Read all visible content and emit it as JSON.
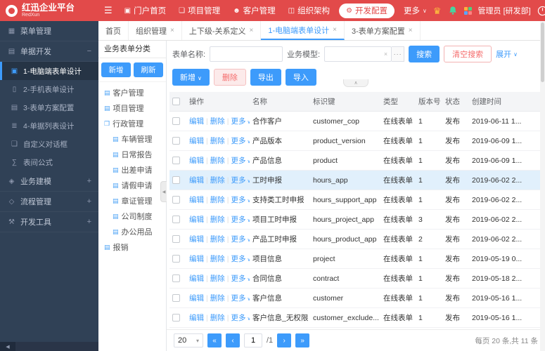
{
  "colors": {
    "brand_red": "#e24a4a",
    "accent_blue": "#3d9bfb",
    "success_green": "#45b34a",
    "danger_red": "#f56c6c",
    "sidebar_bg": "#304156",
    "row_highlight": "#e1f0fc"
  },
  "icons": {
    "hamburger": "☰",
    "caret_down": "∨",
    "select_caret": "▾",
    "close": "×",
    "minus": "−",
    "plus": "+",
    "separator": "|",
    "collapse_up": "∧",
    "collapse_left": "◀",
    "trophy": "♛",
    "page_first": "«",
    "page_prev": "‹",
    "page_next": "›",
    "page_last": "»",
    "model_clear": "×",
    "model_picker": "···"
  },
  "header": {
    "logo_title": "红迅企业平台",
    "logo_subtitle": "RedXun",
    "nav": [
      {
        "id": "portal-home",
        "label": "门户首页",
        "glyph": "▣"
      },
      {
        "id": "project-mgmt",
        "label": "项目管理",
        "glyph": "❏"
      },
      {
        "id": "customer-mgmt",
        "label": "客户管理",
        "glyph": "☻"
      },
      {
        "id": "org-structure",
        "label": "组织架构",
        "glyph": "◫"
      },
      {
        "id": "dev-config",
        "label": "开发配置",
        "glyph": "⚙",
        "active": true
      },
      {
        "id": "more",
        "label": "更多",
        "caret": true
      }
    ],
    "user": "管理员 [研发部]"
  },
  "tabbar": [
    {
      "id": "home",
      "label": "首页",
      "closable": false
    },
    {
      "id": "org-mgmt",
      "label": "组织管理",
      "closable": true
    },
    {
      "id": "relation-def",
      "label": "上下级-关系定义",
      "closable": true
    },
    {
      "id": "pc-form-design",
      "label": "1-电脑端表单设计",
      "closable": true,
      "active": true
    },
    {
      "id": "form-scheme-config",
      "label": "3-表单方案配置",
      "closable": true
    }
  ],
  "sidebar": {
    "items": [
      {
        "id": "menu-mgmt",
        "label": "菜单管理",
        "glyph": "▦",
        "type": "item"
      },
      {
        "id": "doc-dev",
        "label": "单据开发",
        "glyph": "▤",
        "type": "group",
        "expanded": true,
        "children": [
          {
            "id": "pc-form-design",
            "label": "1-电脑端表单设计",
            "glyph": "▣",
            "active": true
          },
          {
            "id": "mobile-form-design",
            "label": "2-手机表单设计",
            "glyph": "▯"
          },
          {
            "id": "form-scheme-config",
            "label": "3-表单方案配置",
            "glyph": "▤"
          },
          {
            "id": "doc-list-design",
            "label": "4-单据列表设计",
            "glyph": "≣"
          },
          {
            "id": "custom-dialog",
            "label": "自定义对话框",
            "glyph": "❑"
          },
          {
            "id": "table-formula",
            "label": "表间公式",
            "glyph": "∑"
          }
        ]
      },
      {
        "id": "biz-modeling",
        "label": "业务建模",
        "glyph": "◈",
        "type": "group",
        "expanded": false
      },
      {
        "id": "process-mgmt",
        "label": "流程管理",
        "glyph": "◇",
        "type": "group",
        "expanded": false
      },
      {
        "id": "dev-tools",
        "label": "开发工具",
        "glyph": "⚒",
        "type": "group",
        "expanded": false
      }
    ]
  },
  "tree_panel": {
    "title": "业务表单分类",
    "add_label": "新增",
    "refresh_label": "刷新",
    "items": [
      {
        "id": "customer-mgmt",
        "label": "客户管理",
        "level": 0,
        "glyph": "▤"
      },
      {
        "id": "project-mgmt",
        "label": "项目管理",
        "level": 0,
        "glyph": "▤"
      },
      {
        "id": "admin-mgmt",
        "label": "行政管理",
        "level": 0,
        "glyph": "❒",
        "folder": true
      },
      {
        "id": "vehicle-mgmt",
        "label": "车辆管理",
        "level": 1,
        "glyph": "▤"
      },
      {
        "id": "daily-report",
        "label": "日常报告",
        "level": 1,
        "glyph": "▤"
      },
      {
        "id": "trip-request",
        "label": "出差申请",
        "level": 1,
        "glyph": "▤"
      },
      {
        "id": "leave-request",
        "label": "请假申请",
        "level": 1,
        "glyph": "▤"
      },
      {
        "id": "seal-mgmt",
        "label": "章证管理",
        "level": 1,
        "glyph": "▤"
      },
      {
        "id": "company-policy",
        "label": "公司制度",
        "level": 1,
        "glyph": "▤"
      },
      {
        "id": "office-supplies",
        "label": "办公用品",
        "level": 1,
        "glyph": "▤"
      },
      {
        "id": "reimbursement",
        "label": "报销",
        "level": 0,
        "glyph": "▤"
      }
    ]
  },
  "filters": {
    "name_label": "表单名称:",
    "name_value": "",
    "model_label": "业务模型:",
    "model_value": "",
    "search_label": "搜索",
    "clear_label": "清空搜索",
    "expand_label": "展开"
  },
  "toolbar": {
    "add_label": "新增",
    "delete_label": "删除",
    "export_label": "导出",
    "import_label": "导入"
  },
  "table": {
    "headers": [
      "操作",
      "名称",
      "标识键",
      "类型",
      "版本号",
      "状态",
      "创建时间"
    ],
    "op_edit": "编辑",
    "op_delete": "删除",
    "op_more": "更多",
    "rows": [
      {
        "name": "合作客户",
        "key": "customer_cop",
        "type": "在线表单",
        "version": "1",
        "status": "发布",
        "created": "2019-06-11 1...",
        "highlight": false
      },
      {
        "name": "产品版本",
        "key": "product_version",
        "type": "在线表单",
        "version": "1",
        "status": "发布",
        "created": "2019-06-09 1...",
        "highlight": false
      },
      {
        "name": "产品信息",
        "key": "product",
        "type": "在线表单",
        "version": "1",
        "status": "发布",
        "created": "2019-06-09 1...",
        "highlight": false
      },
      {
        "name": "工时申报",
        "key": "hours_app",
        "type": "在线表单",
        "version": "1",
        "status": "发布",
        "created": "2019-06-02 2...",
        "highlight": true
      },
      {
        "name": "支持类工时申报",
        "key": "hours_support_app",
        "type": "在线表单",
        "version": "1",
        "status": "发布",
        "created": "2019-06-02 2...",
        "highlight": false
      },
      {
        "name": "项目工时申报",
        "key": "hours_project_app",
        "type": "在线表单",
        "version": "3",
        "status": "发布",
        "created": "2019-06-02 2...",
        "highlight": false
      },
      {
        "name": "产品工时申报",
        "key": "hours_product_app",
        "type": "在线表单",
        "version": "2",
        "status": "发布",
        "created": "2019-06-02 2...",
        "highlight": false
      },
      {
        "name": "项目信息",
        "key": "project",
        "type": "在线表单",
        "version": "1",
        "status": "发布",
        "created": "2019-05-19 0...",
        "highlight": false
      },
      {
        "name": "合同信息",
        "key": "contract",
        "type": "在线表单",
        "version": "1",
        "status": "发布",
        "created": "2019-05-18 2...",
        "highlight": false
      },
      {
        "name": "客户信息",
        "key": "customer",
        "type": "在线表单",
        "version": "1",
        "status": "发布",
        "created": "2019-05-16 1...",
        "highlight": false
      },
      {
        "name": "客户信息_无权限",
        "key": "customer_exclude...",
        "type": "在线表单",
        "version": "1",
        "status": "发布",
        "created": "2019-05-16 1...",
        "highlight": false
      }
    ]
  },
  "pagination": {
    "page_size": "20",
    "current_page": "1",
    "total_pages_label": "/1",
    "summary": "每页 20 条,共 11 条"
  }
}
